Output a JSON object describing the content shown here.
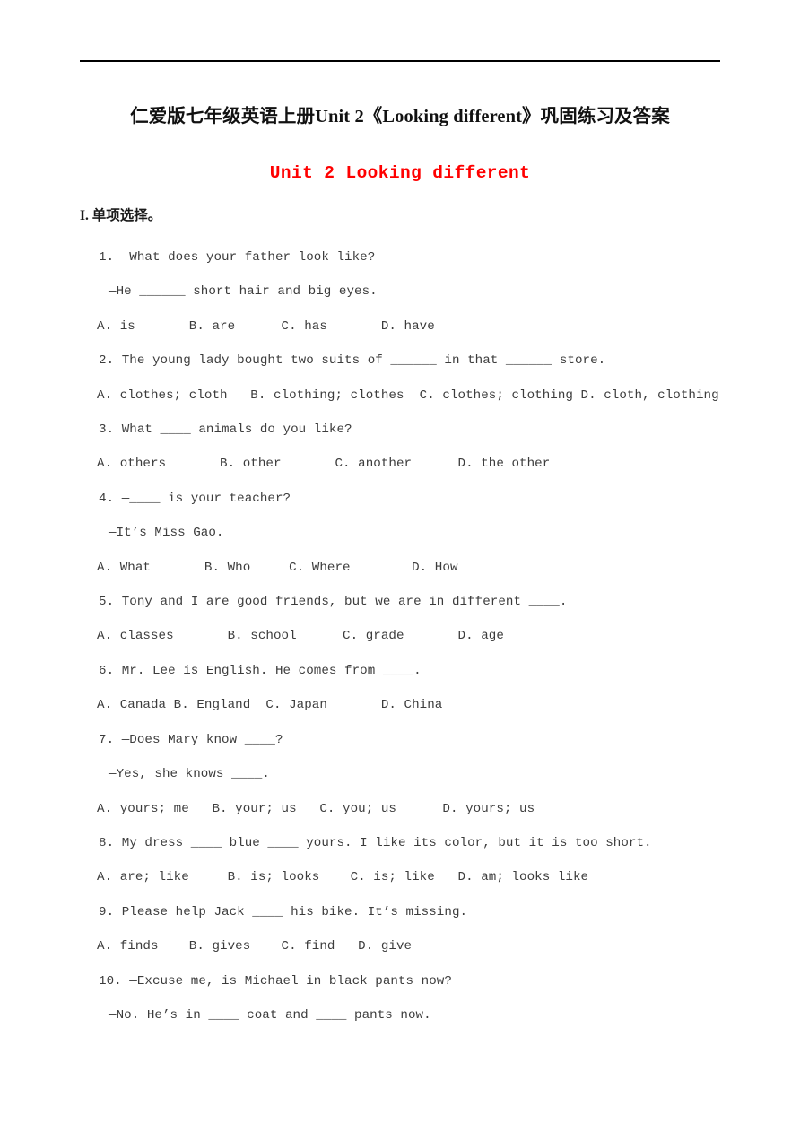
{
  "document": {
    "title": "仁爱版七年级英语上册Unit 2《Looking different》巩固练习及答案",
    "unit_heading": "Unit 2 Looking different",
    "unit_heading_color": "#ff0000",
    "section_header": "I. 单项选择。",
    "body_color": "#3c3c3c",
    "rule_color": "#000000"
  },
  "questions": [
    {
      "stem": "1. —What does your father look like?",
      "cont": "—He ______ short hair and big eyes.",
      "options": "A. is       B. are      C. has       D. have"
    },
    {
      "stem": "2. The young lady bought two suits of ______ in that ______ store.",
      "cont": null,
      "options": "A. clothes; cloth   B. clothing; clothes  C. clothes; clothing D. cloth, clothing"
    },
    {
      "stem": "3. What ____ animals do you like?",
      "cont": null,
      "options": "A. others       B. other       C. another      D. the other"
    },
    {
      "stem": "4. —____ is your teacher?",
      "cont": "—It’s Miss Gao.",
      "options": "A. What       B. Who     C. Where        D. How"
    },
    {
      "stem": "5. Tony and I are good friends, but we are in different ____.",
      "cont": null,
      "options": "A. classes       B. school      C. grade       D. age"
    },
    {
      "stem": "6. Mr. Lee is English. He comes from ____.",
      "cont": null,
      "options": "A. Canada B. England  C. Japan       D. China"
    },
    {
      "stem": "7. —Does Mary know ____?",
      "cont": "—Yes, she knows ____.",
      "options": "A. yours; me   B. your; us   C. you; us      D. yours; us"
    },
    {
      "stem": "8. My dress ____ blue ____ yours. I like its color, but it is too short.",
      "cont": null,
      "options": "A. are; like     B. is; looks    C. is; like   D. am; looks like"
    },
    {
      "stem": "9. Please help Jack ____ his bike. It’s missing.",
      "cont": null,
      "options": "A. finds    B. gives    C. find   D. give"
    },
    {
      "stem": "10. —Excuse me, is Michael in black pants now?",
      "cont": "—No. He’s in ____ coat and ____ pants now.",
      "options": null
    }
  ]
}
